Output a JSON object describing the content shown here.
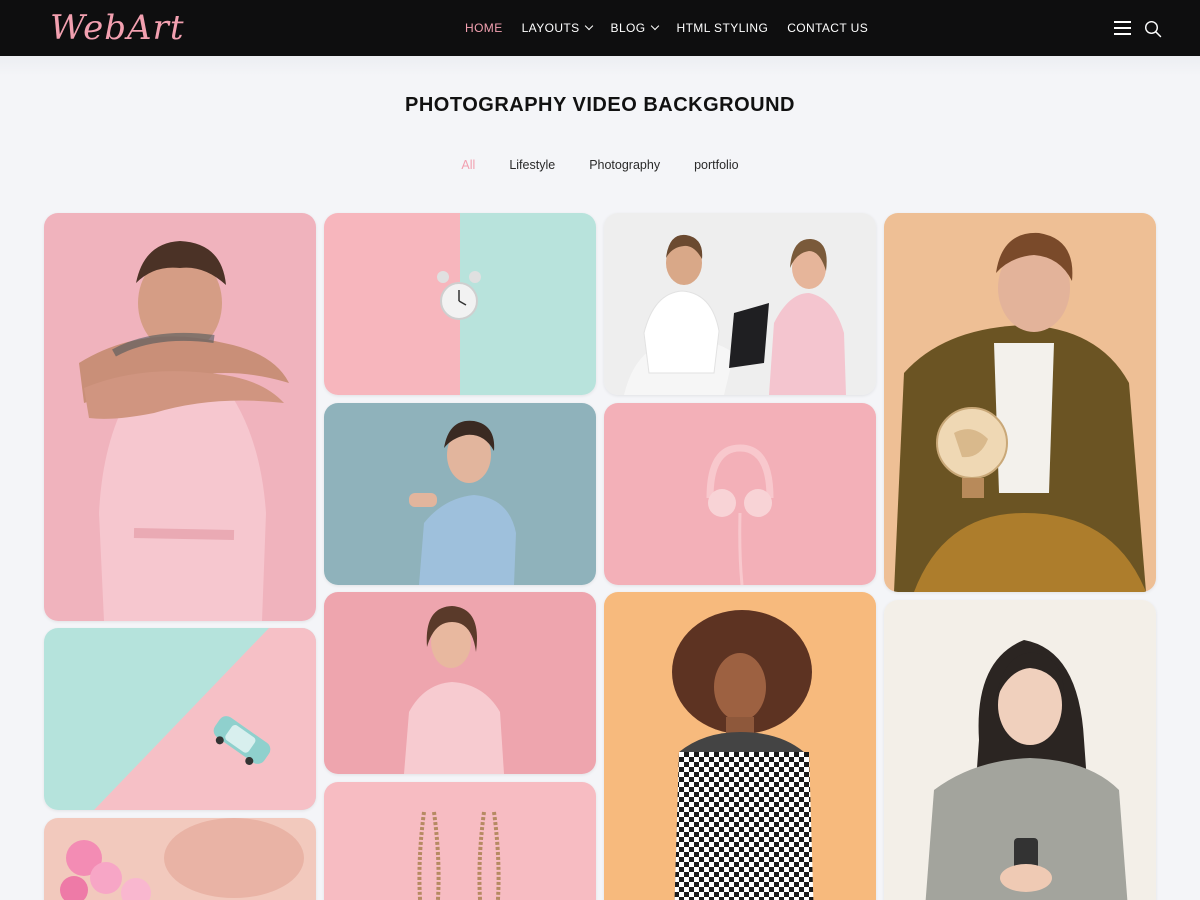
{
  "header": {
    "logo": "WebArt",
    "nav": [
      {
        "label": "HOME",
        "active": true,
        "dropdown": false
      },
      {
        "label": "LAYOUTS",
        "active": false,
        "dropdown": true
      },
      {
        "label": "BLOG",
        "active": false,
        "dropdown": true
      },
      {
        "label": "HTML STYLING",
        "active": false,
        "dropdown": false
      },
      {
        "label": "CONTACT US",
        "active": false,
        "dropdown": false
      }
    ],
    "icons": [
      "hamburger-menu-icon",
      "search-icon"
    ]
  },
  "page": {
    "title": "PHOTOGRAPHY VIDEO BACKGROUND"
  },
  "filters": [
    {
      "label": "All",
      "active": true
    },
    {
      "label": "Lifestyle",
      "active": false
    },
    {
      "label": "Photography",
      "active": false
    },
    {
      "label": "portfolio",
      "active": false
    }
  ],
  "colors": {
    "accent": "#f2a0b0",
    "header_bg": "#0e0e0f",
    "page_bg": "#f4f5f8"
  }
}
